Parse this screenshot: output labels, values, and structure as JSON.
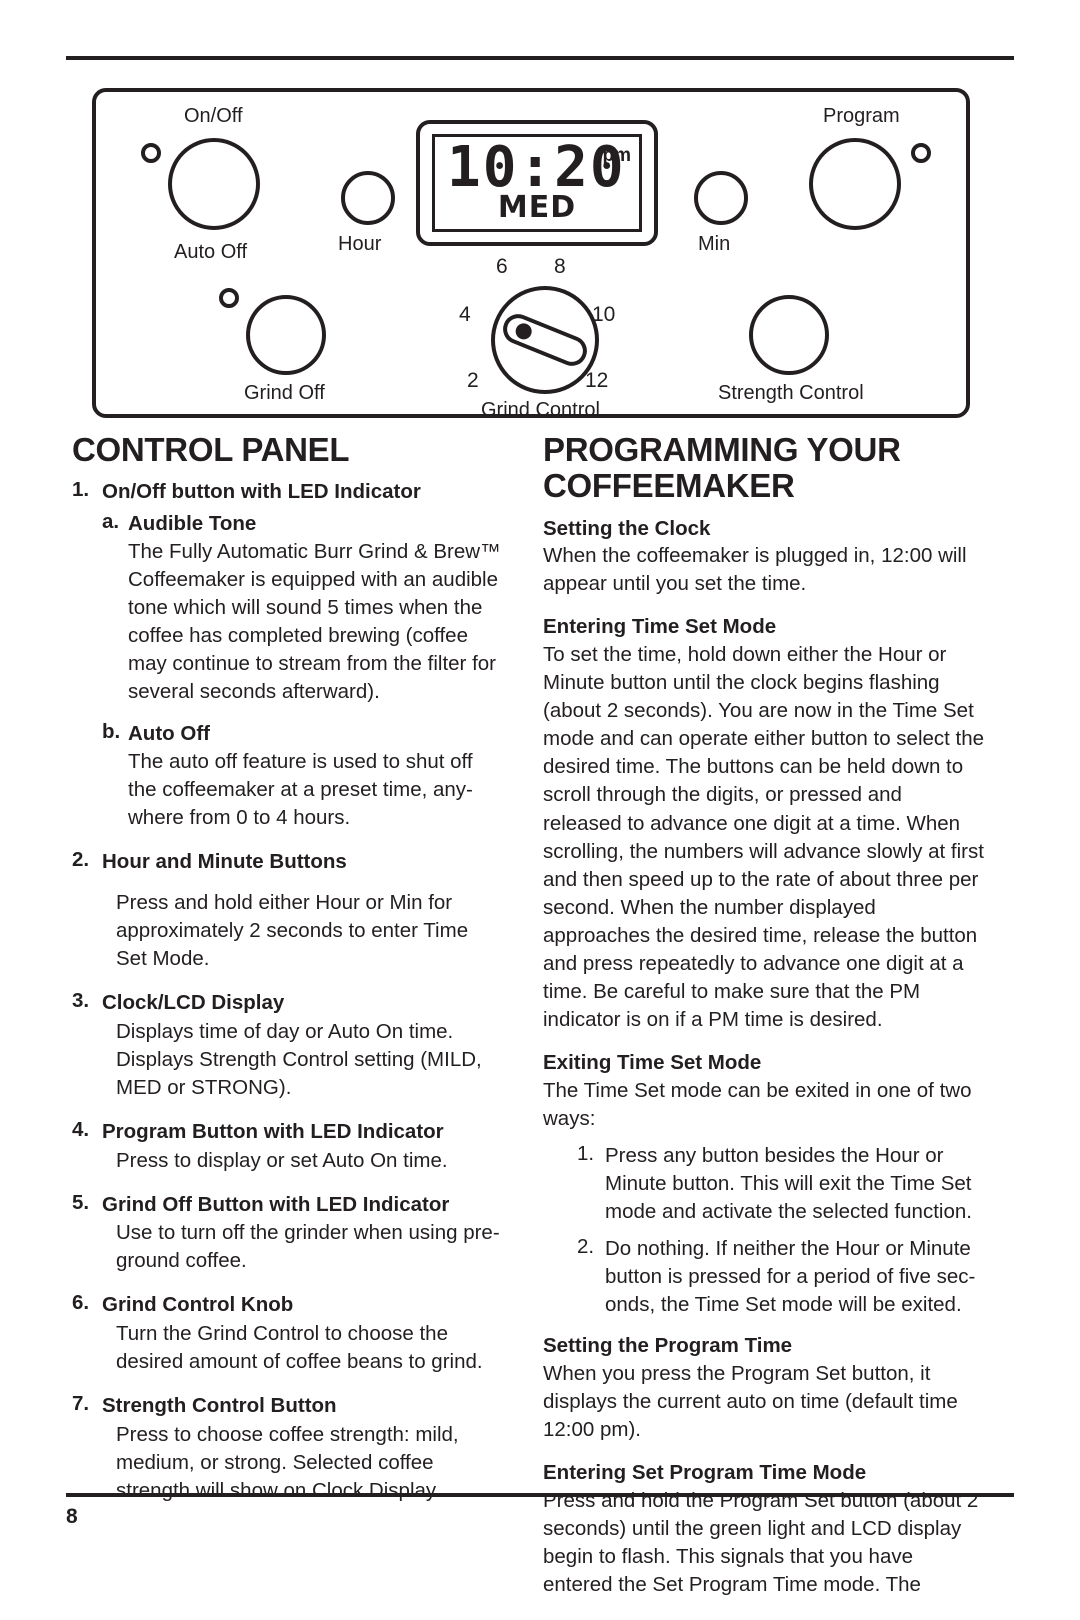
{
  "page": {
    "number": "8"
  },
  "diagram": {
    "name": "coffeemaker-control-panel",
    "labels": {
      "on_off": "On/Off",
      "auto_off": "Auto Off",
      "hour": "Hour",
      "grind_off": "Grind Off",
      "min": "Min",
      "program": "Program",
      "strength_control": "Strength Control",
      "grind_control": "Grind Control"
    },
    "lcd": {
      "time": "10:20",
      "meridiem": "pm",
      "strength": "MED"
    },
    "grind_ticks": [
      "2",
      "4",
      "6",
      "8",
      "10",
      "12"
    ]
  },
  "left_column": {
    "title": "CONTROL PANEL",
    "items": [
      {
        "marker": "1.",
        "title": "On/Off button with LED Indicator",
        "subitems": [
          {
            "marker": "a.",
            "title": "Audible Tone",
            "body": "The Fully Automatic Burr Grind & Brew™ Coffeemaker is equipped with an audible tone which will sound 5 times when the coffee has completed brewing (coffee may continue to stream from the filter for several seconds afterward)."
          },
          {
            "marker": "b.",
            "title": "Auto Off",
            "body": "The auto off feature is used to shut off the coffeemaker at a preset time, any-where from 0 to 4 hours."
          }
        ]
      },
      {
        "marker": "2.",
        "title": "Hour and Minute Buttons",
        "body": "Press and hold either Hour or Min for approximately 2 seconds to enter Time Set Mode."
      },
      {
        "marker": "3.",
        "title": "Clock/LCD Display",
        "body": "Displays time of day or Auto On time. Displays Strength Control setting (MILD, MED or STRONG)."
      },
      {
        "marker": "4.",
        "title": "Program Button with LED Indicator",
        "body": "Press to display or set Auto On time."
      },
      {
        "marker": "5.",
        "title": "Grind Off Button with LED Indicator",
        "body": "Use to turn off the grinder when using pre-ground coffee."
      },
      {
        "marker": "6.",
        "title": "Grind Control Knob",
        "body": "Turn the Grind Control to choose the desired amount of coffee beans to grind."
      },
      {
        "marker": "7.",
        "title": " Strength Control Button",
        "body": "Press to choose coffee strength: mild, medium, or strong. Selected coffee strength will show on Clock Display."
      }
    ]
  },
  "right_column": {
    "title": "PROGRAMMING YOUR COFFEEMAKER",
    "sections": [
      {
        "heading": "Setting the Clock",
        "body": "When the coffeemaker is plugged in, 12:00 will appear until you set the time."
      },
      {
        "heading": "Entering Time Set Mode",
        "body": "To set the time, hold down either the Hour or Minute button until the clock begins flashing (about 2 seconds). You are now in the Time Set mode and can operate either button to select the desired time. The buttons can be held down to scroll through the digits, or pressed and released to advance one digit at a time. When scrolling, the numbers will advance slowly at first and then speed up to the rate of about three per second. When the number displayed approaches the desired time, release the button and press repeatedly to advance one digit at a time. Be careful to make sure that the PM indicator is on if a PM time is desired."
      },
      {
        "heading": "Exiting Time Set Mode",
        "body": "The Time Set mode can be exited in one of two ways:",
        "list": [
          {
            "marker": "1.",
            "body": "Press any button besides the Hour or Minute button. This will exit the Time Set mode and activate the selected function."
          },
          {
            "marker": "2.",
            "body": "Do nothing. If neither the Hour or Minute button is pressed for a period of five sec-onds, the Time Set mode will be exited."
          }
        ]
      },
      {
        "heading": "Setting the Program Time",
        "body": "When you press the Program Set button, it displays the current auto on time (default time 12:00 pm)."
      },
      {
        "heading": "Entering Set Program Time Mode",
        "body": "Press and hold the Program Set button (about 2 seconds) until the green light and LCD display begin to flash. This signals that you have entered the Set Program Time mode. The"
      }
    ]
  }
}
